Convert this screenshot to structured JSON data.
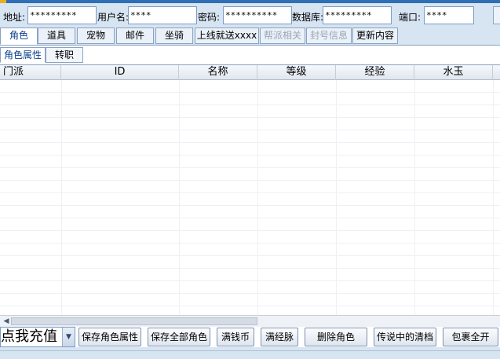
{
  "connection": {
    "address_label": "地址:",
    "address_value": "*********",
    "username_label": "用户名:",
    "username_value": "****",
    "password_label": "密码:",
    "password_value": "**********",
    "database_label": "数据库:",
    "database_value": "*********",
    "port_label": "端口:",
    "port_value": "****"
  },
  "tabs": [
    {
      "label": "角色",
      "state": "active"
    },
    {
      "label": "道具",
      "state": "normal"
    },
    {
      "label": "宠物",
      "state": "normal"
    },
    {
      "label": "邮件",
      "state": "normal"
    },
    {
      "label": "坐骑",
      "state": "normal"
    },
    {
      "label": "上线就送xxxx",
      "state": "normal"
    },
    {
      "label": "帮派相关",
      "state": "disabled"
    },
    {
      "label": "封号信息",
      "state": "disabled"
    },
    {
      "label": "更新内容",
      "state": "normal"
    }
  ],
  "subtabs": [
    {
      "label": "角色属性",
      "state": "active"
    },
    {
      "label": "转职",
      "state": "normal"
    }
  ],
  "table": {
    "columns": [
      "门派",
      "ID",
      "名称",
      "等级",
      "经验",
      "水玉"
    ],
    "rows": []
  },
  "bottom": {
    "recharge_combo": "点我充值",
    "buttons": [
      "保存角色属性",
      "保存全部角色",
      "满钱币",
      "满经脉",
      "删除角色",
      "传说中的清档",
      "包裹全开"
    ]
  },
  "colors": {
    "background": "#d7e4f2",
    "accent": "#2f6fb4",
    "disabled_text": "#9aa6b3"
  }
}
